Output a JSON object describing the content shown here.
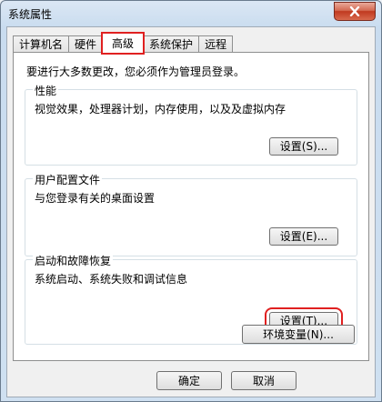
{
  "window": {
    "title": "系统属性"
  },
  "tabs": [
    {
      "label": "计算机名"
    },
    {
      "label": "硬件"
    },
    {
      "label": "高级"
    },
    {
      "label": "系统保护"
    },
    {
      "label": "远程"
    }
  ],
  "notice": "要进行大多数更改，您必须作为管理员登录。",
  "performance": {
    "title": "性能",
    "description": "视觉效果，处理器计划，内存使用，以及及虚拟内存",
    "button": "设置(S)..."
  },
  "user_profiles": {
    "title": "用户配置文件",
    "description": "与您登录有关的桌面设置",
    "button": "设置(E)..."
  },
  "startup_recovery": {
    "title": "启动和故障恢复",
    "description": "系统启动、系统失败和调试信息",
    "button": "设置(T)..."
  },
  "env_button": "环境变量(N)...",
  "footer": {
    "ok": "确定",
    "cancel": "取消"
  },
  "colors": {
    "highlight": "#e02020"
  }
}
